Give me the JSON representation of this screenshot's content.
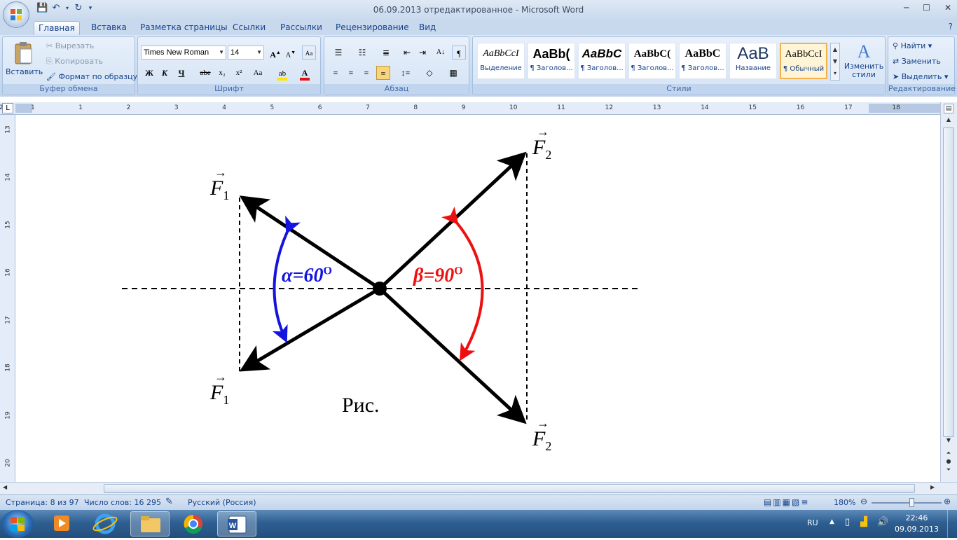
{
  "window": {
    "title": "06.09.2013 отредактированное - Microsoft Word"
  },
  "tabs": [
    "Главная",
    "Вставка",
    "Разметка страницы",
    "Ссылки",
    "Рассылки",
    "Рецензирование",
    "Вид"
  ],
  "clipboard": {
    "paste": "Вставить",
    "cut": "Вырезать",
    "copy": "Копировать",
    "format_painter": "Формат по образцу",
    "group_label": "Буфер обмена"
  },
  "font": {
    "name": "Times New Roman",
    "size": "14",
    "group_label": "Шрифт",
    "bold": "Ж",
    "italic": "К",
    "underline": "Ч",
    "strike": "abe",
    "sub": "x₂",
    "sup": "x²",
    "case": "Aa"
  },
  "paragraph": {
    "group_label": "Абзац"
  },
  "styles": {
    "items": [
      {
        "preview": "AaBbCcI",
        "name": "Выделение"
      },
      {
        "preview": "AaBb(",
        "name": "¶ Заголов..."
      },
      {
        "preview": "AaBbC",
        "name": "¶ Заголов..."
      },
      {
        "preview": "AaBbC(",
        "name": "¶ Заголов..."
      },
      {
        "preview": "AaBbC",
        "name": "¶ Заголов..."
      },
      {
        "preview": "AaB",
        "name": "Название"
      },
      {
        "preview": "AaBbCcI",
        "name": "¶ Обычный"
      }
    ],
    "change": "Изменить стили",
    "group_label": "Стили"
  },
  "editing": {
    "find": "Найти",
    "replace": "Заменить",
    "select": "Выделить",
    "group_label": "Редактирование"
  },
  "ruler": {
    "h": [
      "2",
      "1",
      "1",
      "2",
      "3",
      "4",
      "5",
      "6",
      "7",
      "8",
      "9",
      "10",
      "11",
      "12",
      "13",
      "14",
      "15",
      "16",
      "17",
      "18"
    ],
    "v": [
      "13",
      "14",
      "15",
      "16",
      "17",
      "18",
      "19",
      "20"
    ]
  },
  "figure": {
    "f1_top": "F",
    "f1_top_sub": "1",
    "f2_top": "F",
    "f2_top_sub": "2",
    "f1_bot": "F",
    "f1_bot_sub": "1",
    "f2_bot": "F",
    "f2_bot_sub": "2",
    "alpha": "α=60",
    "alpha_sup": "O",
    "beta": "β=90",
    "beta_sup": "O",
    "caption": "Рис.",
    "colors": {
      "alpha": "#1414e0",
      "beta": "#ee1010"
    }
  },
  "status": {
    "page": "Страница: 8 из 97",
    "words": "Число слов: 16 295",
    "lang": "Русский (Россия)",
    "zoom": "180%"
  },
  "taskbar": {
    "lang": "RU",
    "time": "22:46",
    "date": "09.09.2013"
  }
}
